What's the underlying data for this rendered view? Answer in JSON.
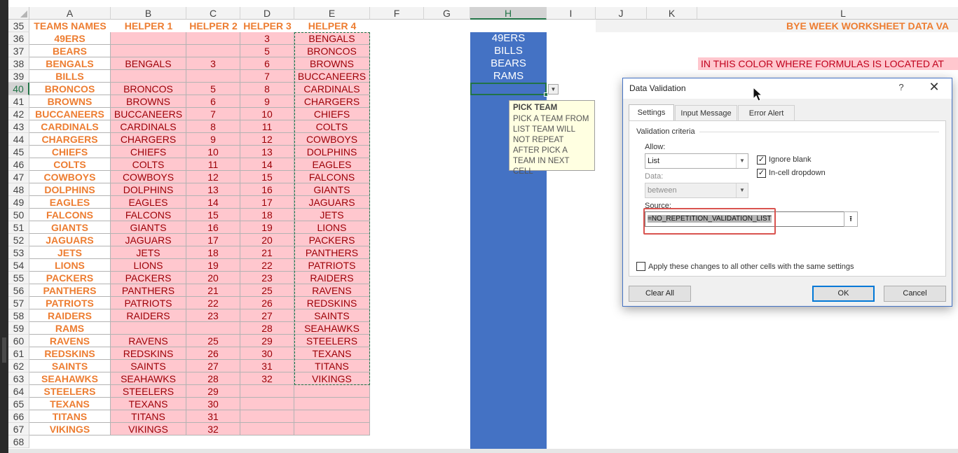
{
  "columns": [
    "A",
    "B",
    "C",
    "D",
    "E",
    "F",
    "G",
    "H",
    "I",
    "J",
    "K",
    "L"
  ],
  "selected_column": "H",
  "selected_row": "40",
  "row_numbers": [
    "35",
    "36",
    "37",
    "38",
    "39",
    "40",
    "41",
    "42",
    "43",
    "44",
    "45",
    "46",
    "47",
    "48",
    "49",
    "50",
    "51",
    "52",
    "53",
    "54",
    "55",
    "56",
    "57",
    "58",
    "59",
    "60",
    "61",
    "62",
    "63",
    "64",
    "65",
    "66",
    "67",
    "68"
  ],
  "headers": [
    "TEAMS NAMES",
    "HELPER 1",
    "HELPER 2",
    "HELPER 3",
    "HELPER 4"
  ],
  "teams": [
    "49ERS",
    "BEARS",
    "BENGALS",
    "BILLS",
    "BRONCOS",
    "BROWNS",
    "BUCCANEERS",
    "CARDINALS",
    "CHARGERS",
    "CHIEFS",
    "COLTS",
    "COWBOYS",
    "DOLPHINS",
    "EAGLES",
    "FALCONS",
    "GIANTS",
    "JAGUARS",
    "JETS",
    "LIONS",
    "PACKERS",
    "PANTHERS",
    "PATRIOTS",
    "RAIDERS",
    "RAMS",
    "RAVENS",
    "REDSKINS",
    "SAINTS",
    "SEAHAWKS",
    "STEELERS",
    "TEXANS",
    "TITANS",
    "VIKINGS"
  ],
  "helper1": [
    "",
    "",
    "BENGALS",
    "",
    "BRONCOS",
    "BROWNS",
    "BUCCANEERS",
    "CARDINALS",
    "CHARGERS",
    "CHIEFS",
    "COLTS",
    "COWBOYS",
    "DOLPHINS",
    "EAGLES",
    "FALCONS",
    "GIANTS",
    "JAGUARS",
    "JETS",
    "LIONS",
    "PACKERS",
    "PANTHERS",
    "PATRIOTS",
    "RAIDERS",
    "",
    "RAVENS",
    "REDSKINS",
    "SAINTS",
    "SEAHAWKS",
    "STEELERS",
    "TEXANS",
    "TITANS",
    "VIKINGS"
  ],
  "helper2": [
    "",
    "",
    "3",
    "",
    "5",
    "6",
    "7",
    "8",
    "9",
    "10",
    "11",
    "12",
    "13",
    "14",
    "15",
    "16",
    "17",
    "18",
    "19",
    "20",
    "21",
    "22",
    "23",
    "",
    "25",
    "26",
    "27",
    "28",
    "29",
    "30",
    "31",
    "32"
  ],
  "helper3": [
    "3",
    "5",
    "6",
    "7",
    "8",
    "9",
    "10",
    "11",
    "12",
    "13",
    "14",
    "15",
    "16",
    "17",
    "18",
    "19",
    "20",
    "21",
    "22",
    "23",
    "25",
    "26",
    "27",
    "28",
    "29",
    "30",
    "31",
    "32",
    "",
    "",
    "",
    ""
  ],
  "helper4": [
    "BENGALS",
    "BRONCOS",
    "BROWNS",
    "BUCCANEERS",
    "CARDINALS",
    "CHARGERS",
    "CHIEFS",
    "COLTS",
    "COWBOYS",
    "DOLPHINS",
    "EAGLES",
    "FALCONS",
    "GIANTS",
    "JAGUARS",
    "JETS",
    "LIONS",
    "PACKERS",
    "PANTHERS",
    "PATRIOTS",
    "RAIDERS",
    "RAVENS",
    "REDSKINS",
    "SAINTS",
    "SEAHAWKS",
    "STEELERS",
    "TEXANS",
    "TITANS",
    "VIKINGS",
    "",
    "",
    "",
    ""
  ],
  "picked": [
    "49ERS",
    "BILLS",
    "BEARS",
    "RAMS"
  ],
  "tooltip": {
    "title": "PICK TEAM",
    "body": "PICK A TEAM FROM LIST TEAM WILL NOT REPEAT AFTER PICK A TEAM IN NEXT CELL"
  },
  "sheet_title": "BYE WEEK WORKSHEET DATA VA",
  "formula_note": "IN THIS COLOR WHERE  FORMULAS  IS LOCATED AT",
  "dialog": {
    "title": "Data Validation",
    "help": "?",
    "close": "✕",
    "tabs": [
      "Settings",
      "Input Message",
      "Error Alert"
    ],
    "group_label": "Validation criteria",
    "allow_label": "Allow:",
    "allow_value": "List",
    "data_label": "Data:",
    "data_value": "between",
    "ignore_blank": "Ignore blank",
    "in_cell_dropdown": "In-cell dropdown",
    "source_label": "Source:",
    "source_value": "=NO_REPETITION_VALIDATION_LIST",
    "apply_all": "Apply these changes to all other cells with the same settings",
    "clear_all": "Clear All",
    "ok": "OK",
    "cancel": "Cancel"
  },
  "colors": {
    "pink_fill": "#ffc7ce",
    "pink_text": "#9c0006",
    "orange": "#ed7d31",
    "blue_fill": "#4472c4",
    "excel_green": "#217346"
  }
}
